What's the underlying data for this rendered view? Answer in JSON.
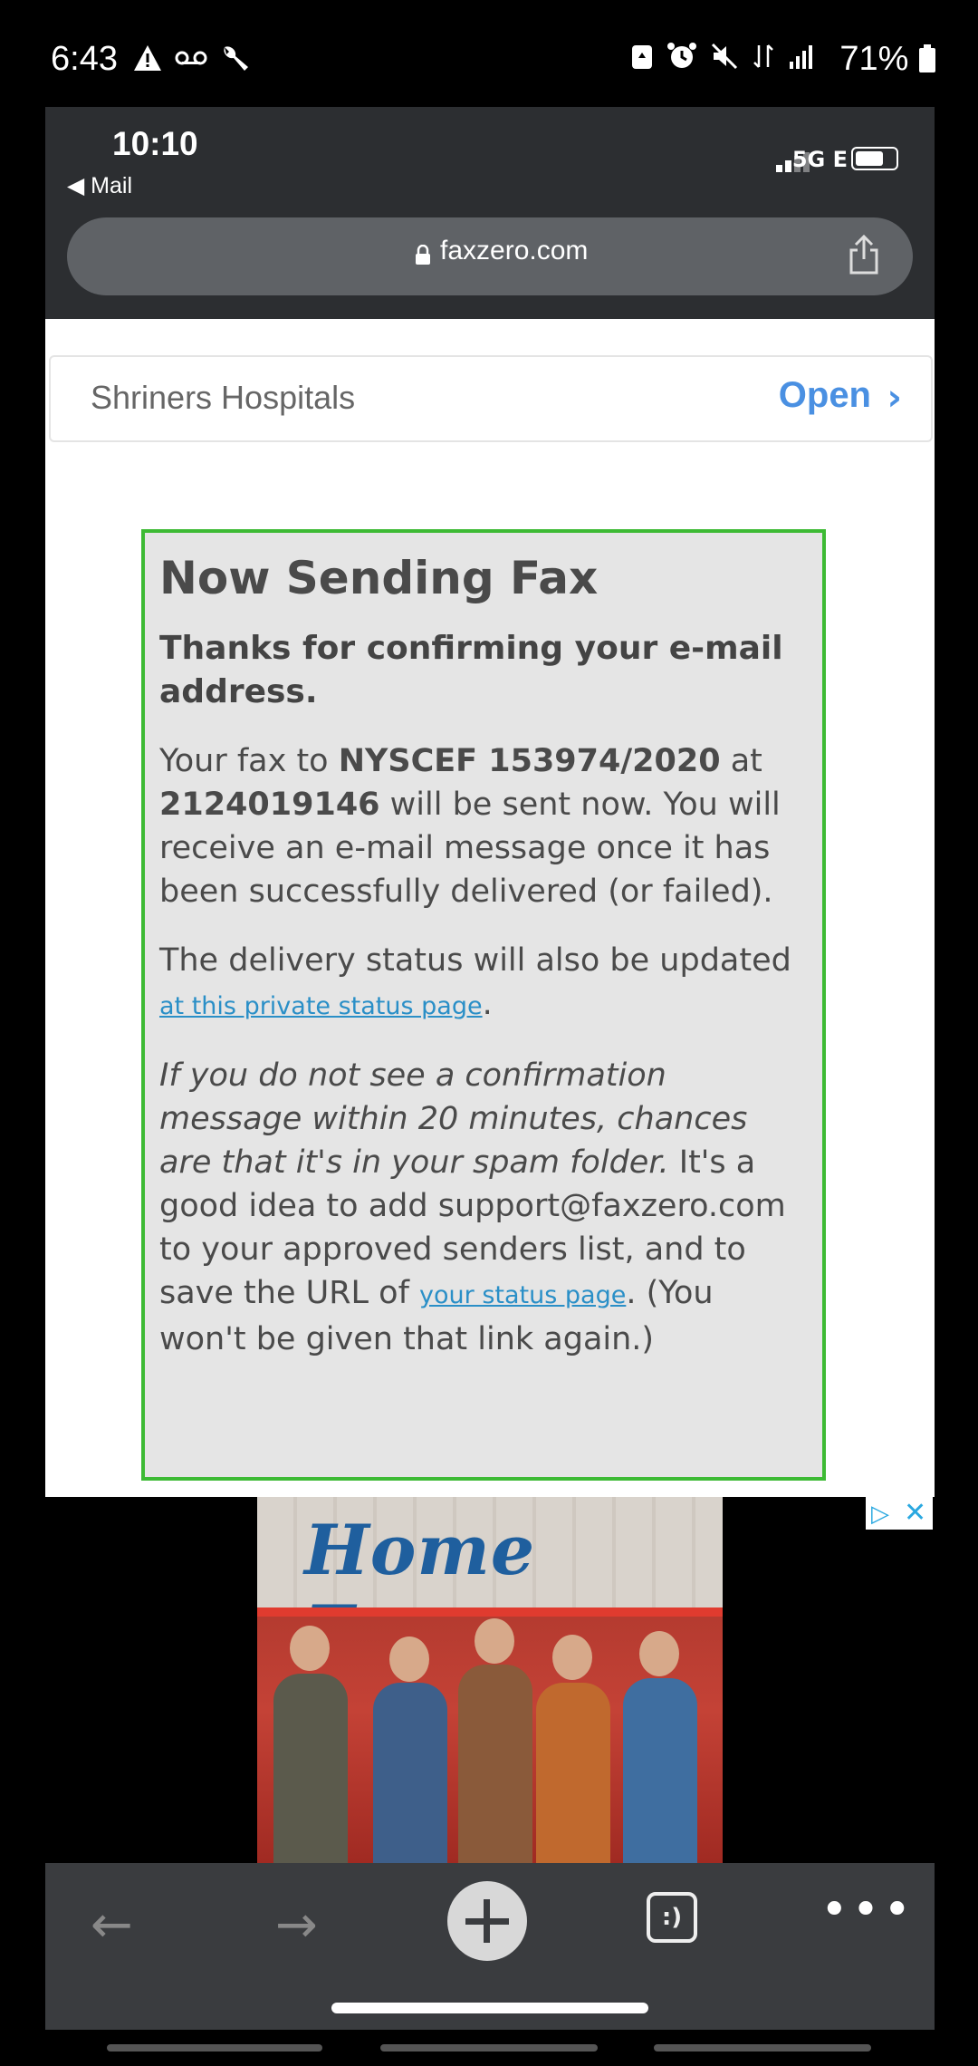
{
  "outer_status": {
    "time": "6:43",
    "battery_pct": "71%"
  },
  "ios_status": {
    "time": "10:10",
    "back_label": "◀ Mail",
    "network": "5G E"
  },
  "browser": {
    "url": "faxzero.com"
  },
  "app_banner": {
    "name": "Shriners Hospitals",
    "action": "Open"
  },
  "fax": {
    "heading": "Now Sending Fax",
    "thanks": "Thanks for confirming your e-mail address.",
    "p1_pre": "Your fax to ",
    "p1_name": "NYSCEF 153974/2020",
    "p1_mid": " at ",
    "p1_number": "2124019146",
    "p1_post": " will be sent now. You will receive an e-mail message once it has been successfully delivered (or failed).",
    "p2_pre": "The delivery status will also be updated ",
    "p2_link": "at this private status page",
    "p2_post": ".",
    "p3_italic": "If you do not see a confirmation message within 20 minutes, chances are that it's in your spam folder.",
    "p3_mid": " It's a good idea to add support@faxzero.com to your approved senders list, and to save the URL of ",
    "p3_link": "your status page",
    "p3_post": ". (You won't be given that link again.)"
  },
  "ad": {
    "title": "Home Free"
  },
  "toolbar": {
    "tabs_label": ":)",
    "more_label": "•••"
  }
}
